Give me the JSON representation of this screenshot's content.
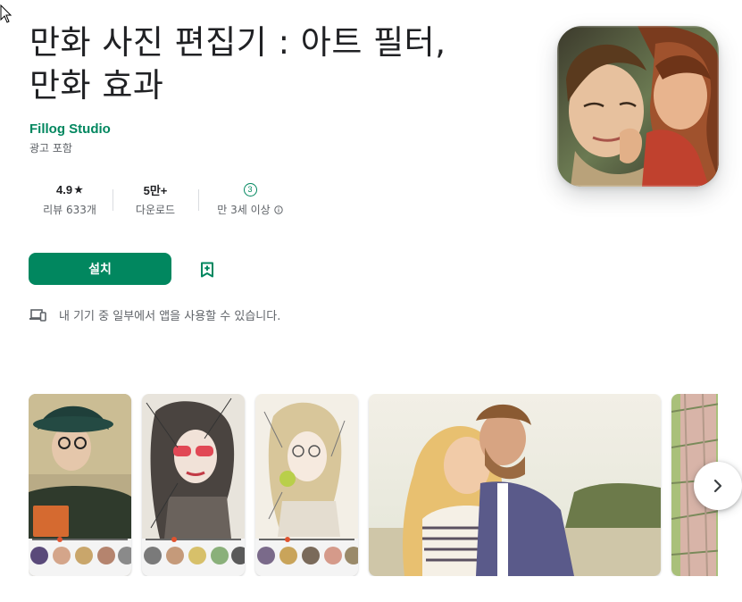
{
  "app": {
    "title_line1": "만화 사진 편집기 : 아트 필터,",
    "title_line2": "만화 효과",
    "developer": "Fillog Studio",
    "ads_note": "광고 포함"
  },
  "stats": {
    "rating_value": "4.9",
    "rating_star": "★",
    "rating_label": "리뷰 633개",
    "downloads_value": "5만+",
    "downloads_label": "다운로드",
    "age_badge": "3",
    "age_label": "만 3세 이상"
  },
  "actions": {
    "install_label": "설치"
  },
  "device_note": "내 기기 중 일부에서 앱을 사용할 수 있습니다.",
  "icons": {
    "wishlist": "bookmark-add-icon",
    "device": "devices-icon",
    "info": "info-icon",
    "next": "chevron-right-icon"
  },
  "colors": {
    "accent": "#01875f",
    "text": "#202124",
    "secondary": "#5f6368"
  }
}
